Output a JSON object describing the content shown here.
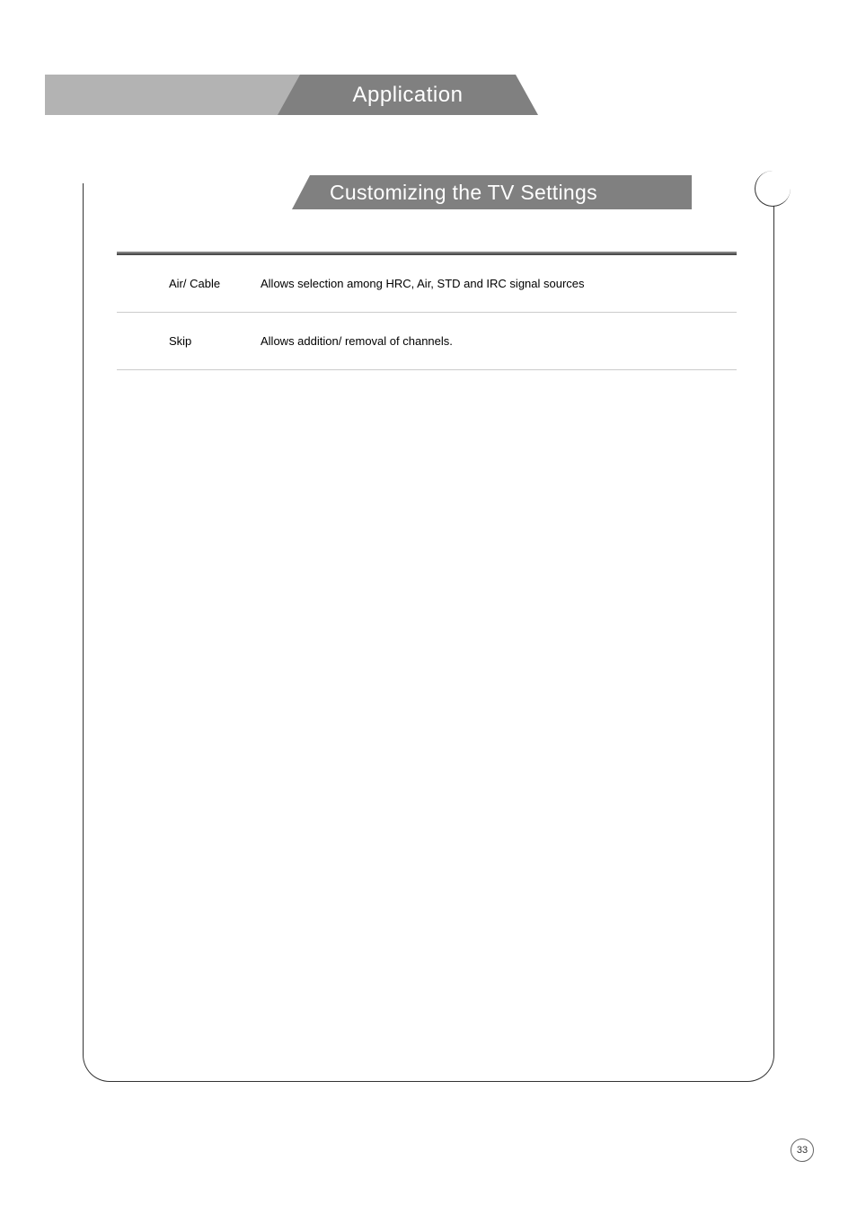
{
  "header": {
    "title": "Application"
  },
  "subheader": {
    "title": "Customizing the TV Settings"
  },
  "settings": [
    {
      "label": "Air/ Cable",
      "description": "Allows selection among HRC, Air, STD and IRC signal sources"
    },
    {
      "label": "Skip",
      "description": "Allows addition/ removal of channels."
    }
  ],
  "page_number": "33"
}
